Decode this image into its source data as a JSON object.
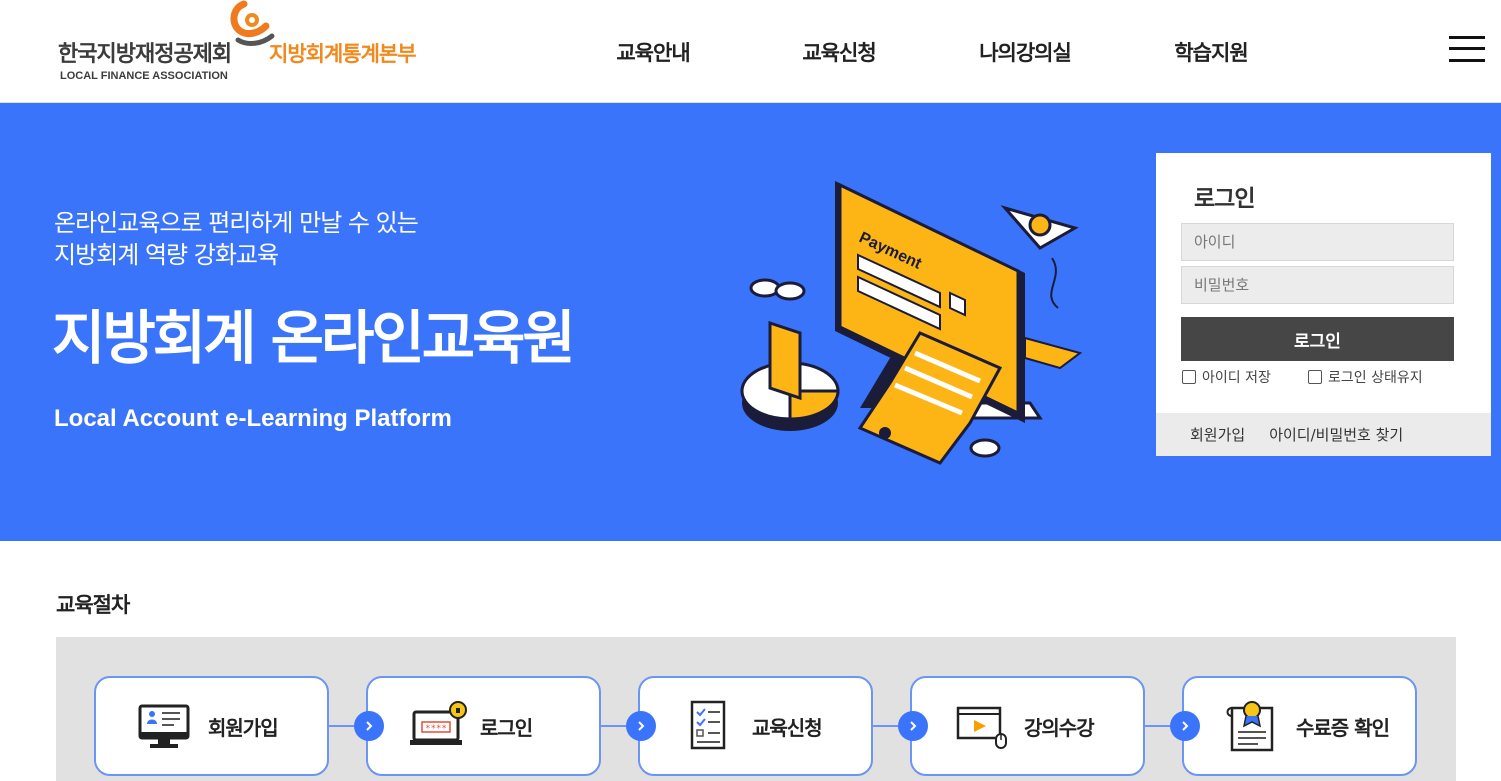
{
  "header": {
    "logo": {
      "org_name": "한국지방재정공제회",
      "org_name_en": "LOCAL FINANCE ASSOCIATION",
      "division": "지방회계통계본부"
    },
    "nav": [
      "교육안내",
      "교육신청",
      "나의강의실",
      "학습지원"
    ],
    "menu_icon": "hamburger-icon"
  },
  "hero": {
    "subtitle_line1": "온라인교육으로 편리하게 만날 수 있는",
    "subtitle_line2": "지방회계 역량 강화교육",
    "title": "지방회계 온라인교육원",
    "title_en": "Local Account e-Learning Platform",
    "illustration_text": "Payment",
    "background_color": "#3a74fa"
  },
  "login": {
    "title": "로그인",
    "id_placeholder": "아이디",
    "pw_placeholder": "비밀번호",
    "submit_label": "로그인",
    "save_id_label": "아이디 저장",
    "keep_login_label": "로그인 상태유지",
    "join_label": "회원가입",
    "find_label": "아이디/비밀번호 찾기"
  },
  "procedure": {
    "title": "교육절차",
    "steps": [
      {
        "label": "회원가입",
        "icon": "monitor-user-icon"
      },
      {
        "label": "로그인",
        "icon": "laptop-lock-icon"
      },
      {
        "label": "교육신청",
        "icon": "checklist-icon"
      },
      {
        "label": "강의수강",
        "icon": "video-play-icon"
      },
      {
        "label": "수료증 확인",
        "icon": "certificate-icon"
      }
    ],
    "accent_color": "#3a74fa"
  }
}
